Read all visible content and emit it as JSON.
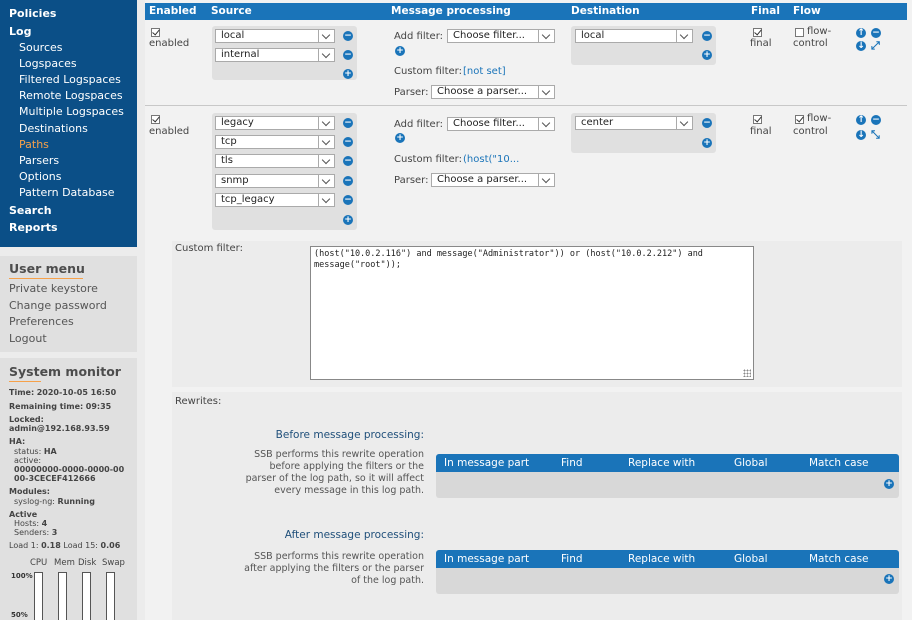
{
  "sidebar": {
    "nav": [
      {
        "label": "Policies",
        "level": "top"
      },
      {
        "label": "Log",
        "level": "top"
      },
      {
        "label": "Sources",
        "level": "sub"
      },
      {
        "label": "Logspaces",
        "level": "sub"
      },
      {
        "label": "Filtered Logspaces",
        "level": "sub"
      },
      {
        "label": "Remote Logspaces",
        "level": "sub"
      },
      {
        "label": "Multiple Logspaces",
        "level": "sub"
      },
      {
        "label": "Destinations",
        "level": "sub"
      },
      {
        "label": "Paths",
        "level": "sub",
        "active": true
      },
      {
        "label": "Parsers",
        "level": "sub"
      },
      {
        "label": "Options",
        "level": "sub"
      },
      {
        "label": "Pattern Database",
        "level": "sub"
      },
      {
        "label": "Search",
        "level": "top"
      },
      {
        "label": "Reports",
        "level": "top"
      }
    ],
    "user_menu": {
      "title": "User menu",
      "items": [
        "Private keystore",
        "Change password",
        "Preferences",
        "Logout"
      ]
    },
    "system_monitor": {
      "title": "System monitor",
      "time_label": "Time:",
      "time": "2020-10-05 16:50",
      "remaining_label": "Remaining time:",
      "remaining": "09:35",
      "locked_label": "Locked:",
      "locked": "admin@192.168.93.59",
      "ha_label": "HA:",
      "ha_status_label": "status:",
      "ha_status": "HA",
      "ha_active_label": "active:",
      "ha_active_1": "00000000-0000-0000-00",
      "ha_active_2": "00-3CECEF412666",
      "modules_label": "Modules:",
      "syslog_label": "syslog-ng:",
      "syslog": "Running",
      "active_label": "Active",
      "hosts_label": "Hosts:",
      "hosts": "4",
      "senders_label": "Senders:",
      "senders": "3",
      "load1_label": "Load 1:",
      "load1": "0.18",
      "load15_label": "Load 15:",
      "load15": "0.06",
      "meters": [
        "CPU",
        "Mem",
        "Disk",
        "Swap"
      ],
      "tick_100": "100%",
      "tick_50": "50%"
    }
  },
  "table": {
    "headers": [
      "Enabled",
      "Source",
      "Message processing",
      "Destination",
      "Final",
      "Flow"
    ],
    "rows": [
      {
        "enabled_label": "enabled",
        "sources": [
          "local",
          "internal"
        ],
        "add_filter_label": "Add filter:",
        "filter_select": "Choose filter...",
        "custom_filter_label": "Custom filter:",
        "custom_filter_value": "[not set]",
        "parser_label": "Parser:",
        "parser_select": "Choose a parser...",
        "destination": "local",
        "final_label": "final",
        "flow_label_1": "flow-",
        "flow_label_2": "control"
      },
      {
        "enabled_label": "enabled",
        "sources": [
          "legacy",
          "tcp",
          "tls",
          "snmp",
          "tcp_legacy"
        ],
        "add_filter_label": "Add filter:",
        "filter_select": "Choose filter...",
        "custom_filter_label": "Custom filter:",
        "custom_filter_value": "(host(\"10...",
        "parser_label": "Parser:",
        "parser_select": "Choose a parser...",
        "destination": "center",
        "final_label": "final",
        "flow_label_1": "flow-",
        "flow_label_2": "control"
      }
    ]
  },
  "custom_filter_editor": {
    "label": "Custom filter:",
    "value": "(host(\"10.0.2.116\") and message(\"Administrator\")) or (host(\"10.0.2.212\") and message(\"root\"));"
  },
  "rewrites": {
    "label": "Rewrites:",
    "before_title": "Before message processing:",
    "before_desc": [
      "SSB performs this rewrite operation",
      "before applying the filters or the",
      "parser of the log path, so it will affect",
      "every message in this log path."
    ],
    "after_title": "After message processing:",
    "after_desc": [
      "SSB performs this rewrite operation",
      "after applying the filters or the parser",
      "of the log path."
    ],
    "columns": [
      "In message part",
      "Find",
      "Replace with",
      "Global",
      "Match case"
    ]
  },
  "colors": {
    "nav_bg": "#0b4f87",
    "accent": "#1a74b9",
    "active_nav": "#f6a14a"
  }
}
